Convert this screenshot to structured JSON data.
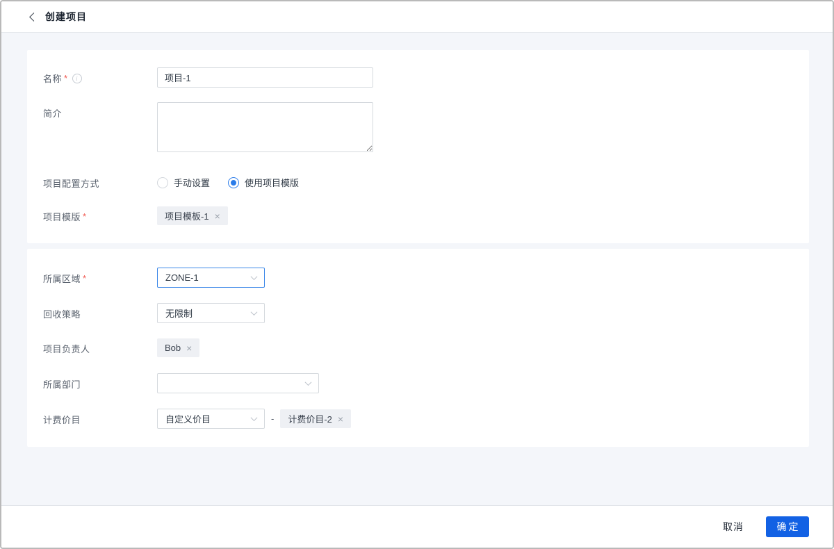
{
  "header": {
    "title": "创建项目"
  },
  "form": {
    "name": {
      "label": "名称",
      "required": "*",
      "value": "项目-1"
    },
    "intro": {
      "label": "简介",
      "value": ""
    },
    "config_mode": {
      "label": "项目配置方式",
      "options": [
        {
          "label": "手动设置",
          "selected": false
        },
        {
          "label": "使用项目模版",
          "selected": true
        }
      ]
    },
    "template": {
      "label": "项目模版",
      "required": "*",
      "tag": "项目模板-1",
      "remove_icon": "×"
    },
    "zone": {
      "label": "所属区域",
      "required": "*",
      "value": "ZONE-1"
    },
    "recycle_policy": {
      "label": "回收策略",
      "value": "无限制"
    },
    "owner": {
      "label": "项目负责人",
      "tag": "Bob",
      "remove_icon": "×"
    },
    "department": {
      "label": "所属部门",
      "value": ""
    },
    "billing": {
      "label": "计费价目",
      "value": "自定义价目",
      "separator": "-",
      "tag": "计费价目-2",
      "remove_icon": "×"
    }
  },
  "footer": {
    "cancel_label": "取消",
    "confirm_label": "确定"
  },
  "colors": {
    "accent_blue": "#1261e4",
    "radio_blue": "#2b7ce9",
    "focus_border_blue": "#3b87e8",
    "required_red": "#f0574f",
    "page_background": "#f4f6fa",
    "tag_background": "#eef0f4"
  }
}
